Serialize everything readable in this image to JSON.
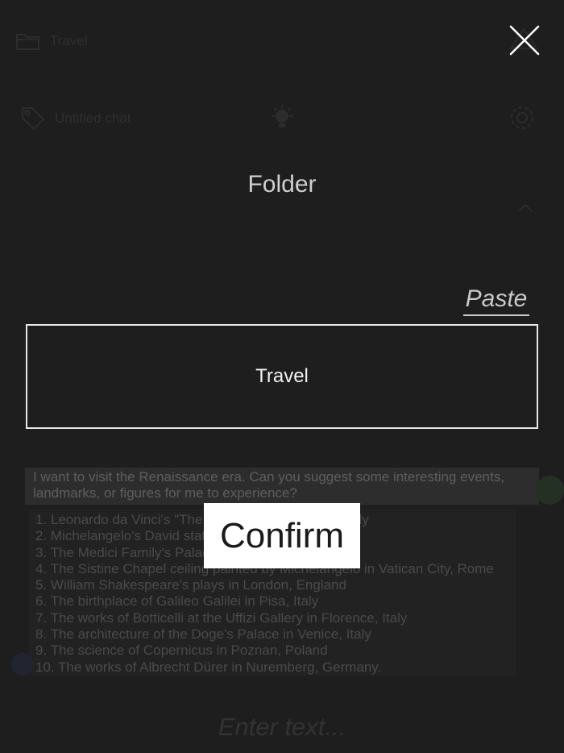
{
  "background": {
    "folder_label": "Travel",
    "tag_label": "Untitled chat",
    "description": "",
    "query": "I want to visit the Renaissance era. Can you suggest some interesting events, landmarks, or figures for me to experience?",
    "answer_lines": [
      "1. Leonardo da Vinci's \"The Last Supper\" in Milan, Italy",
      "2. Michelangelo's David statue in Florence, Italy",
      "3. The Medici Family's Palace in Florence, Italy",
      "4. The Sistine Chapel ceiling painted by Michelangelo in Vatican City, Rome",
      "5. William Shakespeare's plays in London, England",
      "6. The birthplace of Galileo Galilei in Pisa, Italy",
      "7. The works of Botticelli at the Uffizi Gallery in Florence, Italy",
      "8. The architecture of the Doge's Palace in Venice, Italy",
      "9. The science of Copernicus in Poznan, Poland",
      "10. The works of Albrecht Dürer in Nuremberg, Germany."
    ],
    "input_placeholder": "Enter text..."
  },
  "modal": {
    "title": "Folder",
    "paste_label": "Paste",
    "folder_value": "Travel",
    "confirm_label": "Confirm"
  },
  "icons": {
    "close": "close-icon",
    "folder": "folder-icon",
    "tag": "tag-icon",
    "bulb": "lightbulb-icon",
    "gear": "gear-icon",
    "chevron": "chevron-up-icon"
  },
  "colors": {
    "overlay_bg": "#1e1e1e",
    "modal_text": "#cfcfcf",
    "confirm_bg": "#ffffff",
    "input_border": "#e8e8e8"
  }
}
